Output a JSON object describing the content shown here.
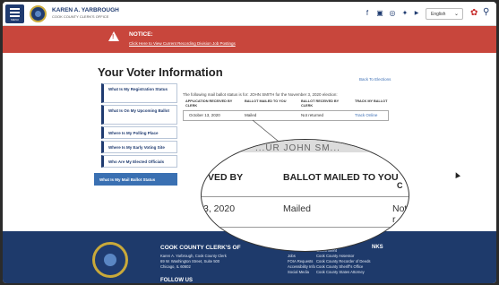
{
  "header": {
    "menu_label": "MENU",
    "brand_name": "KAREN A. YARBROUGH",
    "brand_sub": "COOK COUNTY CLERK'S OFFICE",
    "social": [
      {
        "name": "facebook-icon",
        "glyph": "f"
      },
      {
        "name": "flickr-icon",
        "glyph": "▣"
      },
      {
        "name": "instagram-icon",
        "glyph": "◎"
      },
      {
        "name": "twitter-icon",
        "glyph": "✦"
      },
      {
        "name": "youtube-icon",
        "glyph": "▶"
      }
    ],
    "language": "English",
    "accent": "#1f3b70",
    "alert_color": "#c62828"
  },
  "notice": {
    "title": "NOTICE:",
    "link": "Click Here to View Current Recording Division Job Postings",
    "background": "#c8463c"
  },
  "main": {
    "title": "Your Voter Information",
    "back_link": "Back To Elections",
    "sidebar": [
      {
        "label": "What Is My Registration Status"
      },
      {
        "label": "What Is On My Upcoming Ballot"
      },
      {
        "label": "Where Is My Polling Place"
      },
      {
        "label": "Where Is My Early Voting Site"
      },
      {
        "label": "Who Are My Elected Officials"
      }
    ],
    "active_item": "What Is My Mail Ballot Status",
    "intro": "The following mail ballot status is for: JOHN SMITH for the November 3, 2020 election:",
    "table": {
      "headers": [
        "APPLICATION RECEIVED BY CLERK",
        "BALLOT MAILED TO YOU",
        "BALLOT RECEIVED BY CLERK",
        "TRACK MY BALLOT"
      ],
      "row": [
        "October 13, 2020",
        "Mailed",
        "Not returned",
        "Track Online"
      ]
    }
  },
  "magnifier": {
    "cut_text": "...UR JOHN SM...",
    "col1": "VED BY",
    "col2": "BALLOT MAILED TO YOU",
    "col3": "C",
    "val1": "3, 2020",
    "val2": "Mailed",
    "val3": "Not r"
  },
  "footer": {
    "heading": "COOK COUNTY CLERK'S OF",
    "address": [
      "Karen A. Yarbrough, Cook County Clerk",
      "69 W. Washington Street, Suite 500",
      "Chicago, IL 60602"
    ],
    "follow": "FOLLOW US",
    "col2": [
      "Jobs",
      "FOIA Requests",
      "Accessibility Info",
      "Social Media"
    ],
    "links_heading": "NKS",
    "col3": [
      "Government",
      "Cook County Assessor",
      "Cook County Recorder of Deeds",
      "Cook County Sheriff's Office",
      "Cook County States Attorney"
    ],
    "background": "#1e3a6b"
  }
}
